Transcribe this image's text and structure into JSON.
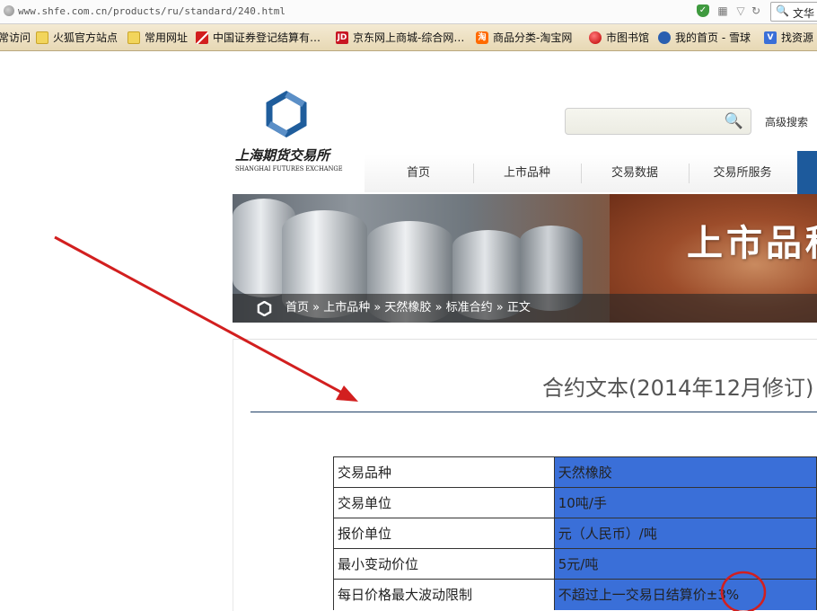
{
  "browser": {
    "url": "www.shfe.com.cn/products/ru/standard/240.html",
    "search_text": "文华",
    "bookmarks": [
      {
        "label": "常访问",
        "icon": "none"
      },
      {
        "label": "火狐官方站点",
        "icon": "folder-icon"
      },
      {
        "label": "常用网址",
        "icon": "folder-icon"
      },
      {
        "label": "中国证券登记结算有…",
        "icon": "chinaclear-icon"
      },
      {
        "label": "京东网上商城-综合网…",
        "icon": "jd-icon",
        "badge": "JD"
      },
      {
        "label": "商品分类-淘宝网",
        "icon": "taobao-icon",
        "badge": "淘"
      },
      {
        "label": "市图书馆",
        "icon": "library-icon"
      },
      {
        "label": "我的首页 - 雪球",
        "icon": "xueqiu-icon"
      },
      {
        "label": "找资源",
        "icon": "v-icon",
        "badge": "V"
      }
    ]
  },
  "site": {
    "logo_cn": "上海期货交易所",
    "logo_en": "SHANGHAI FUTURES EXCHANGE",
    "advanced_search": "高级搜索",
    "nav": [
      "首页",
      "上市品种",
      "交易数据",
      "交易所服务"
    ],
    "banner_title": "上市品种",
    "breadcrumb": "首页 » 上市品种 » 天然橡胶 » 标准合约 » 正文",
    "colors": {
      "nav_accent": "#1d5a9c",
      "logo_blue": "#1f5d9c",
      "annotation_red": "#d21f1f"
    }
  },
  "page": {
    "title": "合约文本(2014年12月修订)",
    "rows": [
      {
        "key": "交易品种",
        "value": "天然橡胶"
      },
      {
        "key": "交易单位",
        "value": "10吨/手"
      },
      {
        "key": "报价单位",
        "value": "元（人民币）/吨"
      },
      {
        "key": "最小变动价位",
        "value": "5元/吨"
      },
      {
        "key": "每日价格最大波动限制",
        "value": "不超过上一交易日结算价±3%"
      }
    ]
  }
}
